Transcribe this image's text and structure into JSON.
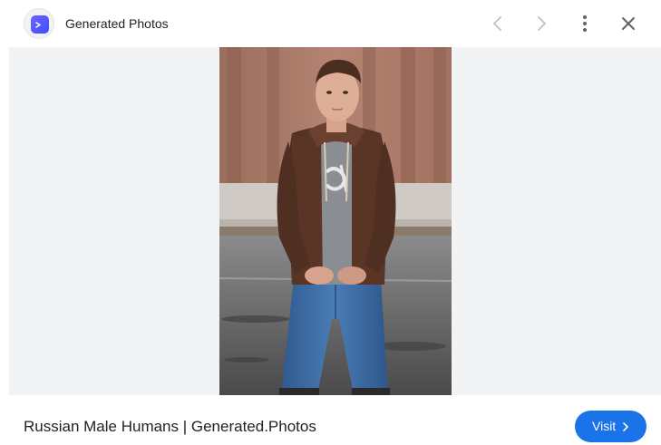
{
  "header": {
    "site_name": "Generated Photos",
    "site_logo_icon": "terminal-prompt-icon",
    "prev_icon": "chevron-left-icon",
    "next_icon": "chevron-right-icon",
    "more_icon": "more-vertical-icon",
    "close_icon": "close-icon",
    "logo_color": "#4f46ff"
  },
  "image": {
    "alt": "Russian Male Humans | Generated.Photos"
  },
  "footer": {
    "caption": "Russian Male Humans | Generated.Photos",
    "visit_label": "Visit",
    "visit_icon": "chevron-right-icon",
    "visit_color": "#1a73e8"
  }
}
